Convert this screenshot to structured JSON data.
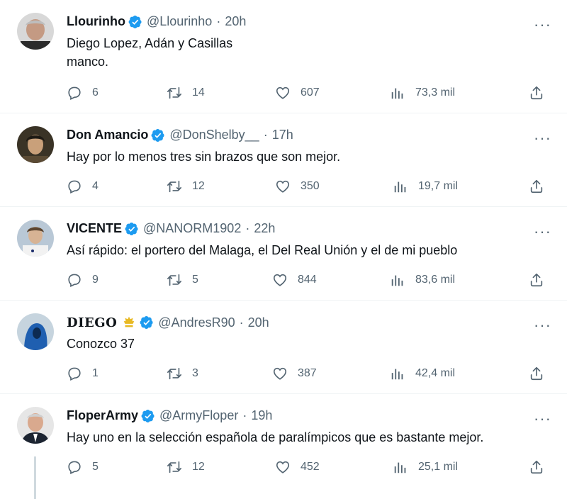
{
  "tweets": [
    {
      "name": "Llourinho",
      "handle": "@Llourinho",
      "time": "20h",
      "text_lines": [
        "Diego Lopez, Adán y Casillas",
        "manco."
      ],
      "replies": "6",
      "retweets": "14",
      "likes": "607",
      "views": "73,3 mil"
    },
    {
      "name": "Don Amancio",
      "handle": "@DonShelby__",
      "time": "17h",
      "text_lines": [
        "Hay por lo menos tres sin brazos que son mejor."
      ],
      "replies": "4",
      "retweets": "12",
      "likes": "350",
      "views": "19,7 mil"
    },
    {
      "name": "VICENTE",
      "handle": "@NANORM1902",
      "time": "22h",
      "text_lines": [
        "Así rápido: el portero del Malaga, el Del Real Unión y el de mi pueblo"
      ],
      "replies": "9",
      "retweets": "5",
      "likes": "844",
      "views": "83,6 mil"
    },
    {
      "name": "DIEGO",
      "handle": "@AndresR90",
      "time": "20h",
      "text_lines": [
        "Conozco 37"
      ],
      "replies": "1",
      "retweets": "3",
      "likes": "387",
      "views": "42,4 mil"
    },
    {
      "name": "FloperArmy",
      "handle": "@ArmyFloper",
      "time": "19h",
      "text_lines": [
        "Hay uno en la selección española de paralímpicos que es bastante mejor."
      ],
      "replies": "5",
      "retweets": "12",
      "likes": "452",
      "views": "25,1 mil"
    }
  ],
  "separator": "·",
  "more_glyph": "···",
  "colors": {
    "verified": "#1d9bf0",
    "secondary_text": "#536471",
    "divider": "#eff3f4",
    "crown": "#e8b923"
  }
}
